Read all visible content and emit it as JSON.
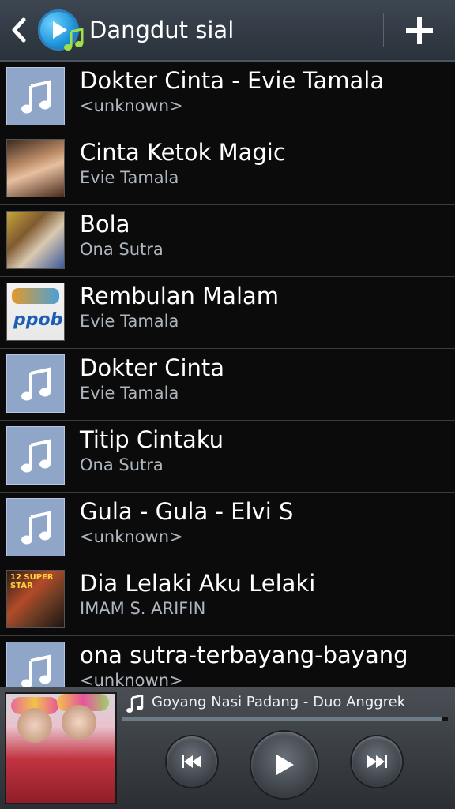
{
  "header": {
    "title": "Dangdut sial",
    "back_icon": "chevron-left-icon",
    "app_icon": "music-player-app-icon",
    "add_icon": "plus-icon"
  },
  "songs": [
    {
      "title": "Dokter Cinta - Evie Tamala",
      "artist": "<unknown>",
      "art": "music-note-icon"
    },
    {
      "title": "Cinta Ketok Magic",
      "artist": "Evie Tamala",
      "art": "album-art"
    },
    {
      "title": "Bola",
      "artist": "Ona Sutra",
      "art": "album-art"
    },
    {
      "title": "Rembulan Malam",
      "artist": "Evie Tamala",
      "art": "album-art"
    },
    {
      "title": "Dokter Cinta",
      "artist": "Evie Tamala",
      "art": "music-note-icon"
    },
    {
      "title": "Titip Cintaku",
      "artist": "Ona Sutra",
      "art": "music-note-icon"
    },
    {
      "title": "Gula - Gula - Elvi S",
      "artist": "<unknown>",
      "art": "music-note-icon"
    },
    {
      "title": "Dia Lelaki Aku Lelaki",
      "artist": "IMAM S. ARIFIN",
      "art": "album-art"
    },
    {
      "title": "ona sutra-terbayang-bayang",
      "artist": "<unknown>",
      "art": "music-note-icon"
    }
  ],
  "player": {
    "now_playing": "Goyang Nasi Padang - Duo Anggrek",
    "progress_fraction": 0.98,
    "colors": {
      "accent": "#8fa6c9",
      "header": "#2f3740"
    }
  }
}
